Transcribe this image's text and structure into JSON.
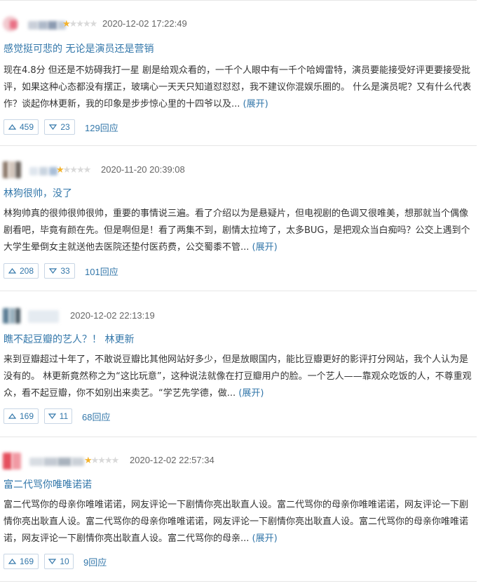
{
  "reviews": [
    {
      "rating": 0.5,
      "rating_stars": "★★★★★",
      "date": "2020-12-02 17:22:49",
      "title": "感觉挺可悲的 无论是演员还是营销",
      "body_lines": [
        "现在4.8分 但还是不妨碍我打一星 剧是给观众看的，一千个人眼中有一千个哈姆雷特，演员要能接受好评更要接受批",
        "评，如果这种心态都没有摆正，玻璃心一天天只知道怼怼怼，我不建议你混娱乐圈的。 什么是演员呢？又有什么代表",
        "作？谈起你林更新，我的印象是步步惊心里的十四爷以及..."
      ],
      "more": "(展开)",
      "useful": "459",
      "useless": "23",
      "replies": "129回应"
    },
    {
      "rating": 1,
      "rating_stars": "★★★★★",
      "date": "2020-11-20 20:39:08",
      "title": "林狗很帅，没了",
      "body_lines": [
        "林狗帅真的很帅很帅很帅，重要的事情说三遍。看了介绍以为是悬疑片，但电视剧的色调又很唯美，想那就当个偶像",
        "剧看吧，毕竟有颜在先。但是啊但是！看了两集不到，剧情太拉垮了，太多BUG，是把观众当白痴吗？公交上遇到个",
        "大学生晕倒女主就送他去医院还垫付医药费，公交蜀黍不管..."
      ],
      "more": "(展开)",
      "useful": "208",
      "useless": "33",
      "replies": "101回应"
    },
    {
      "rating": null,
      "rating_stars": "",
      "date": "2020-12-02 22:13:19",
      "title": "瞧不起豆瓣的艺人？！ 林更新",
      "body_lines": [
        "来到豆瓣超过十年了，不敢说豆瓣比其他网站好多少，但是放眼国内，能比豆瓣更好的影评打分网站，我个人认为是",
        "没有的。 林更新竟然称之为“这比玩意”，这种说法就像在打豆瓣用户的脸。一个艺人——靠观众吃饭的人，不尊重观",
        "众，看不起豆瓣，你不如别出来卖艺。“学艺先学德，做..."
      ],
      "more": "(展开)",
      "useful": "169",
      "useless": "11",
      "replies": "68回应"
    },
    {
      "rating": 1,
      "rating_stars": "★★★★★",
      "date": "2020-12-02 22:57:34",
      "title": "富二代骂你唯唯诺诺",
      "body_lines": [
        "富二代骂你的母亲你唯唯诺诺，网友评论一下剧情你亮出耿直人设。富二代骂你的母亲你唯唯诺诺，网友评论一下剧",
        "情你亮出耿直人设。富二代骂你的母亲你唯唯诺诺，网友评论一下剧情你亮出耿直人设。富二代骂你的母亲你唯唯诺",
        "诺，网友评论一下剧情你亮出耿直人设。富二代骂你的母亲..."
      ],
      "more": "(展开)",
      "useful": "169",
      "useless": "10",
      "replies": "9回应"
    }
  ],
  "colors": {
    "link": "#3377aa",
    "star_on": "#f4b32c",
    "star_off": "#d9d9d9"
  },
  "icons": {
    "useful": "triangle-up-icon",
    "useless": "triangle-down-icon"
  }
}
